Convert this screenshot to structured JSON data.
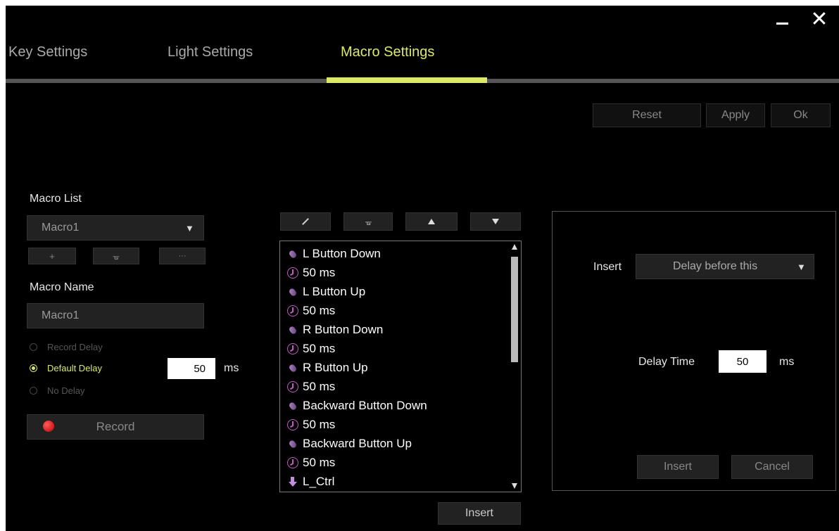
{
  "window": {
    "minimize_glyph": "",
    "close_glyph": "✕"
  },
  "tabs": [
    {
      "label": "Key Settings",
      "active": false
    },
    {
      "label": "Light Settings",
      "active": false
    },
    {
      "label": "Macro Settings",
      "active": true
    }
  ],
  "colors": {
    "accent": "#dde86a",
    "icon": "#c15ac1",
    "background": "#000000",
    "button": "#222222"
  },
  "top_actions": {
    "reset": "Reset",
    "apply": "Apply",
    "ok": "Ok"
  },
  "macro_list": {
    "label": "Macro List",
    "selected": "Macro1",
    "add_glyph": "+",
    "delete_glyph": "ᚗ",
    "more_glyph": "···"
  },
  "macro_name": {
    "label": "Macro Name",
    "value": "Macro1"
  },
  "delay_options": {
    "record_delay": "Record Delay",
    "default_delay": "Default Delay",
    "no_delay": "No Delay",
    "selected": "default_delay",
    "default_value": "50",
    "unit": "ms"
  },
  "record": {
    "label": "Record"
  },
  "event_toolbar": {
    "edit_icon": "pencil-icon",
    "delete_icon": "trash-icon",
    "up_icon": "move-up-icon",
    "down_icon": "move-down-icon"
  },
  "events": [
    {
      "icon": "mouse",
      "text": "L Button Down"
    },
    {
      "icon": "clock",
      "text": "50 ms"
    },
    {
      "icon": "mouse",
      "text": "L Button Up"
    },
    {
      "icon": "clock",
      "text": "50 ms"
    },
    {
      "icon": "mouse",
      "text": "R Button Down"
    },
    {
      "icon": "clock",
      "text": "50 ms"
    },
    {
      "icon": "mouse",
      "text": "R Button Up"
    },
    {
      "icon": "clock",
      "text": "50 ms"
    },
    {
      "icon": "mouse",
      "text": "Backward Button Down"
    },
    {
      "icon": "clock",
      "text": "50 ms"
    },
    {
      "icon": "mouse",
      "text": "Backward Button Up"
    },
    {
      "icon": "clock",
      "text": "50 ms"
    },
    {
      "icon": "keydown",
      "text": "L_Ctrl"
    }
  ],
  "list_insert_button": "Insert",
  "insert_panel": {
    "insert_label": "Insert",
    "insert_type": "Delay before this",
    "delay_time_label": "Delay Time",
    "delay_time_value": "50",
    "delay_unit": "ms",
    "insert_button": "Insert",
    "cancel_button": "Cancel"
  }
}
